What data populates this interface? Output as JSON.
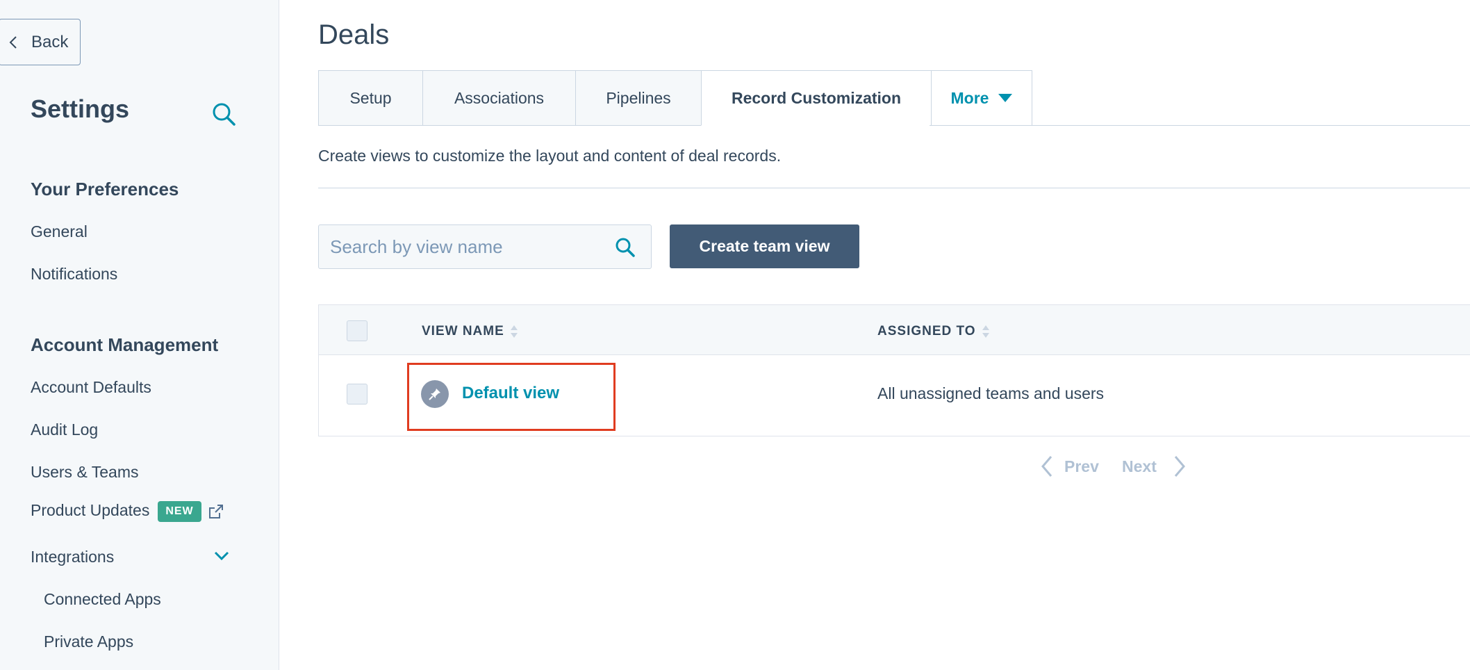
{
  "sidebar": {
    "back_label": "Back",
    "title": "Settings",
    "sections": [
      {
        "heading": "Your Preferences",
        "items": [
          "General",
          "Notifications"
        ]
      },
      {
        "heading": "Account Management",
        "items": [
          "Account Defaults",
          "Audit Log",
          "Users & Teams",
          "Product Updates",
          "Integrations"
        ]
      }
    ],
    "new_badge": "NEW",
    "sub_items": [
      "Connected Apps",
      "Private Apps"
    ]
  },
  "main": {
    "title": "Deals",
    "tabs": [
      "Setup",
      "Associations",
      "Pipelines",
      "Record Customization",
      "More"
    ],
    "active_tab": "Record Customization",
    "description": "Create views to customize the layout and content of deal records.",
    "search_placeholder": "Search by view name",
    "create_button": "Create team view",
    "table": {
      "columns": [
        "VIEW NAME",
        "ASSIGNED TO"
      ],
      "rows": [
        {
          "view_name": "Default view",
          "assigned_to": "All unassigned teams and users"
        }
      ]
    },
    "pagination": {
      "prev": "Prev",
      "next": "Next"
    }
  },
  "colors": {
    "accent": "#0091ae",
    "primary_button": "#425b76",
    "badge": "#3aa78f",
    "highlight": "#e03c20"
  },
  "icons": [
    "chevron-left-icon",
    "search-icon",
    "external-link-icon",
    "chevron-down-icon",
    "caret-down-icon",
    "sort-icon",
    "pin-icon",
    "chevron-right-icon"
  ]
}
